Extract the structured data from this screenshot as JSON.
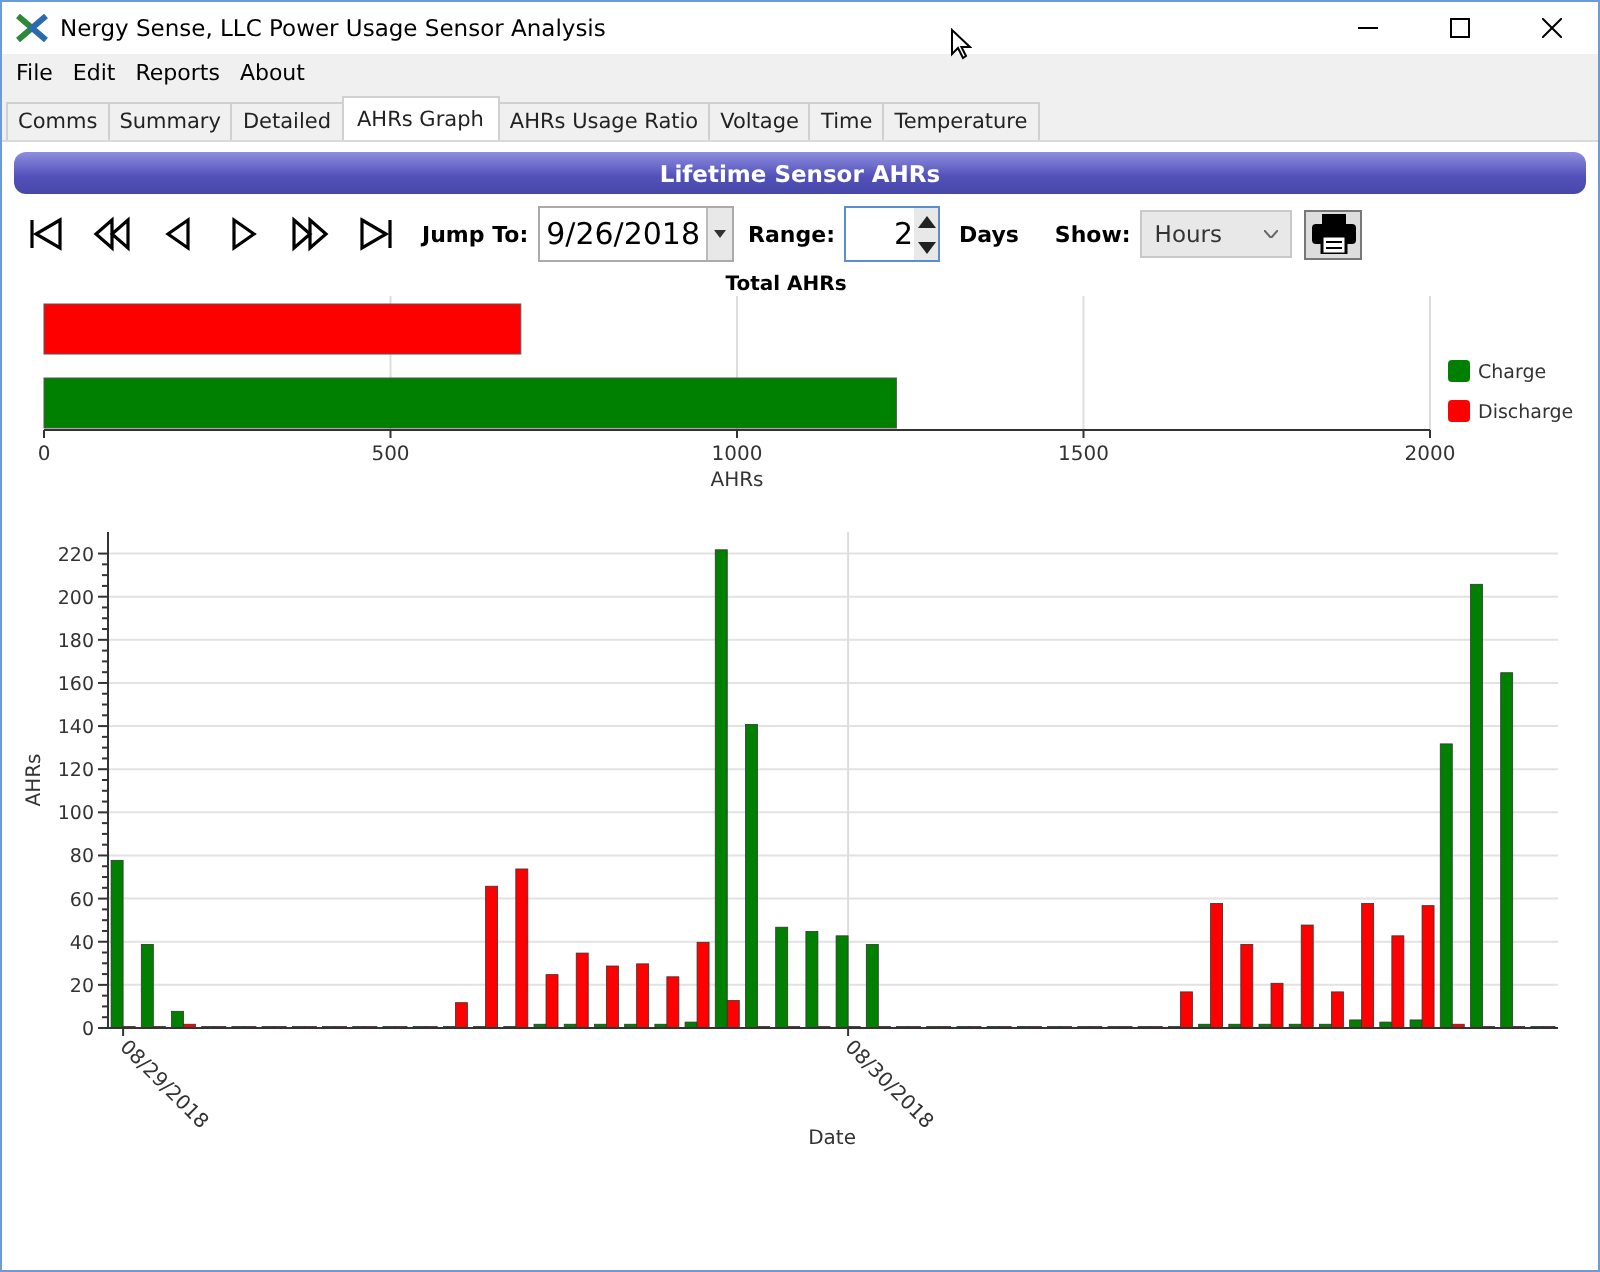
{
  "window": {
    "title": "Nergy Sense, LLC Power Usage Sensor Analysis"
  },
  "menu": [
    "File",
    "Edit",
    "Reports",
    "About"
  ],
  "tabs": [
    {
      "label": "Comms",
      "selected": false
    },
    {
      "label": "Summary",
      "selected": false
    },
    {
      "label": "Detailed",
      "selected": false
    },
    {
      "label": "AHRs Graph",
      "selected": true
    },
    {
      "label": "AHRs Usage Ratio",
      "selected": false
    },
    {
      "label": "Voltage",
      "selected": false
    },
    {
      "label": "Time",
      "selected": false
    },
    {
      "label": "Temperature",
      "selected": false
    }
  ],
  "header": "Lifetime Sensor AHRs",
  "toolbar": {
    "jump_label": "Jump To:",
    "date": "9/26/2018",
    "range_label": "Range:",
    "range": "2",
    "range_unit": "Days",
    "show_label": "Show:",
    "show": "Hours"
  },
  "total_chart": {
    "chart_data": {
      "type": "bar",
      "orientation": "horizontal",
      "grid": true,
      "legend": true,
      "title": "Total AHRs",
      "xlabel": "AHRs",
      "series": [
        {
          "name": "Charge",
          "color": "#008000",
          "values": [
            1230
          ]
        },
        {
          "name": "Discharge",
          "color": "#ff0000",
          "values": [
            688
          ]
        }
      ],
      "xlim": [
        0,
        2000
      ],
      "xticks": [
        0,
        500,
        1000,
        1500,
        2000
      ]
    }
  },
  "hourly_chart": {
    "chart_data": {
      "type": "bar",
      "grid": true,
      "xlabel": "Date",
      "ylabel": "AHRs",
      "categories": [
        "08/29/2018",
        null,
        null,
        null,
        null,
        null,
        null,
        null,
        null,
        null,
        null,
        null,
        null,
        null,
        null,
        null,
        null,
        null,
        null,
        null,
        null,
        null,
        null,
        null,
        "08/30/2018",
        null,
        null,
        null,
        null,
        null,
        null,
        null,
        null,
        null,
        null,
        null,
        null,
        null,
        null,
        null,
        null,
        null,
        null,
        null,
        null,
        null,
        null,
        null
      ],
      "ylim": [
        0,
        230
      ],
      "yticks": [
        0,
        20,
        40,
        60,
        80,
        100,
        120,
        140,
        160,
        180,
        200,
        220
      ],
      "series": [
        {
          "color": "#008000",
          "values": [
            77,
            38,
            7,
            0,
            0,
            0,
            0,
            0,
            0,
            0,
            0,
            0,
            0,
            0,
            1,
            1,
            1,
            1,
            1,
            2,
            221,
            140,
            46,
            44,
            42,
            38,
            0,
            0,
            0,
            0,
            0,
            0,
            0,
            0,
            0,
            0,
            1,
            1,
            1,
            1,
            1,
            3,
            2,
            3,
            131,
            205,
            164,
            0
          ]
        },
        {
          "color": "#ff0000",
          "values": [
            0,
            0,
            1,
            0,
            0,
            0,
            0,
            0,
            0,
            0,
            0,
            11,
            65,
            73,
            24,
            34,
            28,
            29,
            23,
            39,
            12,
            0,
            0,
            0,
            0,
            0,
            0,
            0,
            0,
            0,
            0,
            0,
            0,
            0,
            0,
            16,
            57,
            38,
            20,
            47,
            16,
            57,
            42,
            56,
            1,
            0,
            0,
            0
          ]
        }
      ]
    }
  }
}
